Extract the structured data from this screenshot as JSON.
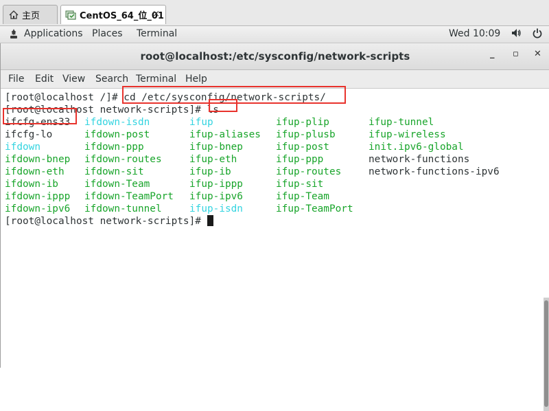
{
  "vm_tabs": {
    "home_label": "主页",
    "vm_label": "CentOS_64_位_01",
    "close_symbol": "×"
  },
  "topbar": {
    "applications": "Applications",
    "places": "Places",
    "terminal": "Terminal",
    "clock": "Wed 10:09",
    "volume_icon": "volume-icon",
    "power_icon": "power-icon"
  },
  "window": {
    "title": "root@localhost:/etc/sysconfig/network-scripts",
    "minimize": "_",
    "maximize": "▫",
    "close": "✕"
  },
  "menubar": {
    "file": "File",
    "edit": "Edit",
    "view": "View",
    "search": "Search",
    "terminal": "Terminal",
    "help": "Help"
  },
  "terminal": {
    "cmd1_prompt": "[root@localhost /]# ",
    "cmd1": "cd /etc/sysconfig/network-scripts/",
    "cmd2_prompt": "[root@localhost network-scripts]# ",
    "cmd2": "ls",
    "final_prompt": "[root@localhost network-scripts]# ",
    "listing_rows": [
      [
        "ifcfg-ens33",
        "ifdown-isdn",
        "ifup",
        "ifup-plip",
        "ifup-tunnel"
      ],
      [
        "ifcfg-lo",
        "ifdown-post",
        "ifup-aliases",
        "ifup-plusb",
        "ifup-wireless"
      ],
      [
        "ifdown",
        "ifdown-ppp",
        "ifup-bnep",
        "ifup-post",
        "init.ipv6-global"
      ],
      [
        "ifdown-bnep",
        "ifdown-routes",
        "ifup-eth",
        "ifup-ppp",
        "network-functions"
      ],
      [
        "ifdown-eth",
        "ifdown-sit",
        "ifup-ib",
        "ifup-routes",
        "network-functions-ipv6"
      ],
      [
        "ifdown-ib",
        "ifdown-Team",
        "ifup-ippp",
        "ifup-sit",
        ""
      ],
      [
        "ifdown-ippp",
        "ifdown-TeamPort",
        "ifup-ipv6",
        "ifup-Team",
        ""
      ],
      [
        "ifdown-ipv6",
        "ifdown-tunnel",
        "ifup-isdn",
        "ifup-TeamPort",
        ""
      ]
    ],
    "listing_colors": [
      [
        "plain",
        "cyan",
        "cyan",
        "green",
        "green"
      ],
      [
        "plain",
        "green",
        "green",
        "green",
        "green"
      ],
      [
        "cyan",
        "green",
        "green",
        "green",
        "green"
      ],
      [
        "green",
        "green",
        "green",
        "green",
        "plain"
      ],
      [
        "green",
        "green",
        "green",
        "green",
        "plain"
      ],
      [
        "green",
        "green",
        "green",
        "green",
        ""
      ],
      [
        "green",
        "green",
        "green",
        "green",
        ""
      ],
      [
        "green",
        "green",
        "cyan",
        "green",
        ""
      ]
    ]
  },
  "colors": {
    "executable_green": "#19a52b",
    "symlink_cyan": "#34d4e0",
    "highlight_red": "#e8322c",
    "text": "#2e3436"
  }
}
